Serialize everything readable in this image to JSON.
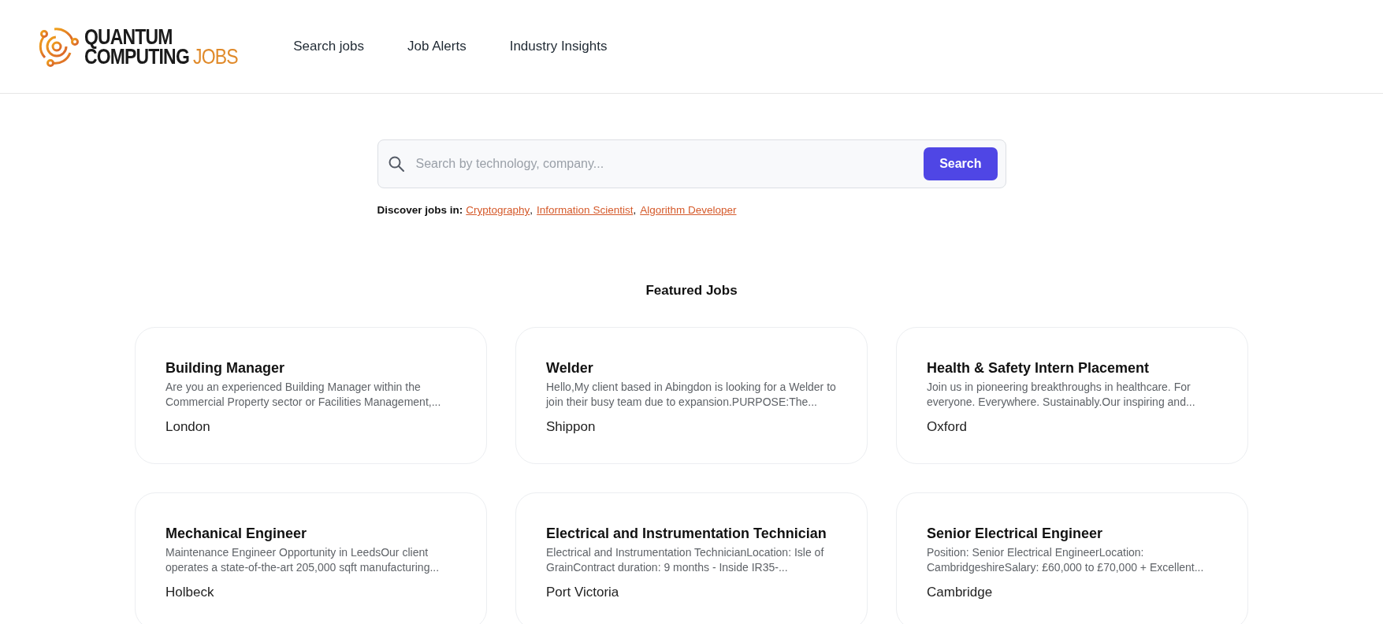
{
  "logo": {
    "line_1": "QUANTUM",
    "line_2": "COMPUTING",
    "accent": "JOBS"
  },
  "nav": [
    {
      "label": "Search jobs"
    },
    {
      "label": "Job Alerts"
    },
    {
      "label": "Industry Insights"
    }
  ],
  "search": {
    "placeholder": "Search by technology, company...",
    "button": "Search"
  },
  "discover": {
    "label": "Discover jobs in:",
    "links": [
      "Cryptography",
      "Information Scientist",
      "Algorithm Developer"
    ],
    "separator": ","
  },
  "featured": {
    "title": "Featured Jobs",
    "jobs": [
      {
        "title": "Building Manager",
        "description": "Are you an experienced Building Manager within the Commercial Property sector or Facilities Management,...",
        "location": "London"
      },
      {
        "title": "Welder",
        "description": "Hello,My client based in Abingdon is looking for a Welder to join their busy team due to expansion.PURPOSE:The...",
        "location": "Shippon"
      },
      {
        "title": "Health & Safety Intern Placement",
        "description": "Join us in pioneering breakthroughs in healthcare. For everyone. Everywhere. Sustainably.Our inspiring and...",
        "location": "Oxford"
      },
      {
        "title": "Mechanical Engineer",
        "description": "Maintenance Engineer Opportunity in LeedsOur client operates a state-of-the-art 205,000 sqft manufacturing...",
        "location": "Holbeck"
      },
      {
        "title": "Electrical and Instrumentation Technician",
        "description": "Electrical and Instrumentation TechnicianLocation: Isle of GrainContract duration: 9 months - Inside IR35-...",
        "location": "Port Victoria"
      },
      {
        "title": "Senior Electrical Engineer",
        "description": "Position: Senior Electrical EngineerLocation: CambridgeshireSalary: £60,000 to £70,000 + Excellent...",
        "location": "Cambridge"
      }
    ]
  }
}
